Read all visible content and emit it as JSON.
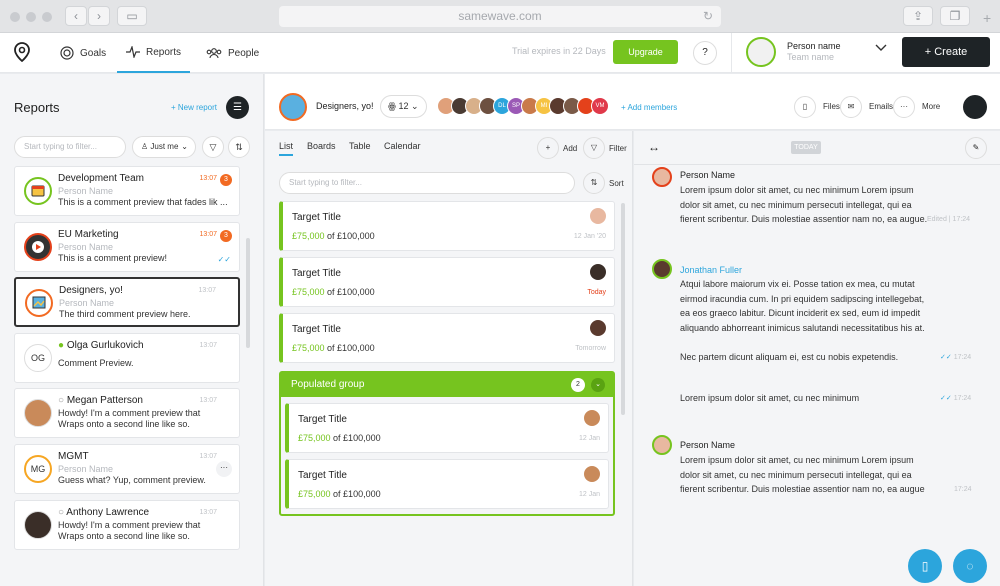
{
  "browser": {
    "url": "samewave.com",
    "new_tab": "+"
  },
  "nav": {
    "goals": "Goals",
    "reports": "Reports",
    "people": "People",
    "trial": "Trial expires in 22 Days",
    "upgrade": "Upgrade",
    "help": "?",
    "person_name": "Person name",
    "team_name": "Team name",
    "create": "+ Create"
  },
  "left": {
    "title": "Reports",
    "new_report": "+ New report",
    "filter_placeholder": "Start typing to filter...",
    "just_me": "Just me",
    "cards": [
      {
        "title": "Development Team",
        "subtitle": "Person Name",
        "preview": "This is a comment preview that fades lik ...",
        "time": "13:07",
        "badge": "3"
      },
      {
        "title": "EU Marketing",
        "subtitle": "Person Name",
        "preview": "This is a comment preview!",
        "time": "13:07",
        "badge": "3"
      },
      {
        "title": "Designers, yo!",
        "subtitle": "Person Name",
        "preview": "The third comment preview here.",
        "time": "13:07"
      },
      {
        "title": "Olga Gurlukovich",
        "initials": "OG",
        "preview": "Comment Preview.",
        "time": "13:07"
      },
      {
        "title": "Megan Patterson",
        "preview": "Howdy! I'm a comment preview that",
        "preview2": "Wraps onto a second line like so.",
        "time": "13:07"
      },
      {
        "title": "MGMT",
        "initials": "MG",
        "subtitle": "Person Name",
        "preview": "Guess what? Yup, comment preview.",
        "time": "13:07"
      },
      {
        "title": "Anthony Lawrence",
        "preview": "Howdy! I'm a comment preview that",
        "preview2": "Wraps onto a second line like so.",
        "time": "13:07"
      }
    ]
  },
  "project": {
    "title": "Designers, yo!",
    "member_count": "12",
    "member_initials": [
      "DL",
      "SP",
      "MI",
      "VM"
    ],
    "add_members": "+ Add members",
    "files": "Files",
    "emails": "Emails",
    "more": "More"
  },
  "list": {
    "tabs": [
      "List",
      "Boards",
      "Table",
      "Calendar"
    ],
    "add": "Add",
    "filter": "Filter",
    "sort": "Sort",
    "filter_placeholder": "Start typing to filter...",
    "tasks": [
      {
        "title": "Target Title",
        "amount": "£75,000",
        "of": " of £100,000",
        "date": "12 Jan '20"
      },
      {
        "title": "Target Title",
        "amount": "£75,000",
        "of": " of £100,000",
        "date": "Today"
      },
      {
        "title": "Target Title",
        "amount": "£75,000",
        "of": " of £100,000",
        "date": "Tomorrow"
      }
    ],
    "group": {
      "title": "Populated group",
      "count": "2",
      "tasks": [
        {
          "title": "Target Title",
          "amount": "£75,000",
          "of": " of £100,000",
          "date": "12 Jan"
        },
        {
          "title": "Target Title",
          "amount": "£75,000",
          "of": " of £100,000",
          "date": "12 Jan"
        }
      ]
    }
  },
  "chat": {
    "today": "TODAY",
    "messages": [
      {
        "name": "Person Name",
        "text": "Lorem ipsum dolor sit amet, cu nec minimum Lorem ipsum dolor sit amet, cu nec minimum persecuti intellegat, qui ea fierent scribentur. Duis molestiae assentior nam no, ea augue.",
        "time": "Edited | 17:24"
      },
      {
        "name": "Jonathan Fuller",
        "text": "Atqui labore maiorum vix ei. Posse tation ex mea, cu mutat eirmod iracundia cum. In pri equidem sadipscing intellegebat, ea eos graeco labitur. Dicunt inciderit ex sed, eum id impedit aliquando abhorreant inimicus salutandi necessitatibus his at."
      },
      {
        "text": "Nec partem dicunt aliquam ei, est cu nobis expetendis.",
        "time": "17:24"
      },
      {
        "text": "Lorem ipsum dolor sit amet, cu nec minimum",
        "time": "17:24"
      },
      {
        "name": "Person Name",
        "text": "Lorem ipsum dolor sit amet, cu nec minimum Lorem ipsum dolor sit amet, cu nec minimum persecuti intellegat, qui ea fierent scribentur. Duis molestiae assentior nam no, ea augue",
        "time": "17:24"
      }
    ]
  },
  "colors": {
    "accent": "#2ca5dc",
    "green": "#76c41f",
    "orange": "#f26a22",
    "dark": "#1e2326"
  }
}
